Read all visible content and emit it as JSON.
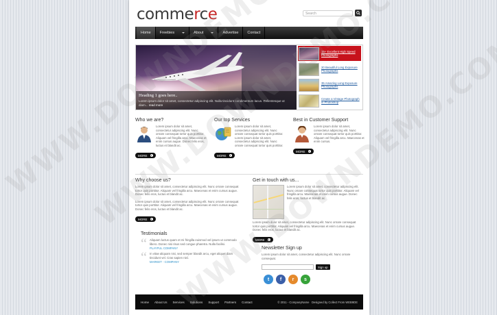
{
  "site": {
    "logo_prefix": "comme",
    "logo_accent": "r",
    "logo_mid": "c",
    "logo_suffix": "e"
  },
  "search": {
    "placeholder": "Search",
    "icon": "search-icon"
  },
  "nav": {
    "items": [
      {
        "label": "Home",
        "active": true
      },
      {
        "label": "Freebies",
        "dropdown": true
      },
      {
        "label": "About",
        "dropdown": true
      },
      {
        "label": "Advertise"
      },
      {
        "label": "Contact"
      }
    ]
  },
  "slider": {
    "hero_title": "Heading 1 goes here..",
    "hero_text": "Lorem ipsum dolor sit amet, consectetur adipiscing elit. Nulla tincidunt condimentum lacus. Pellentesque ut diam...",
    "hero_more": "read more",
    "thumbs": [
      {
        "caption": "15+ Excellent High Speed Photographs",
        "active": true
      },
      {
        "caption": "20 Beautiful Long Exposure Photographs"
      },
      {
        "caption": "35 Amazing Long Exposure Photographs"
      },
      {
        "caption": "Create a Vintage Photograph in Photoshop"
      }
    ]
  },
  "features": [
    {
      "title": "Who we are?",
      "icon": "person-icon",
      "text": "Lorem ipsum dolor sit amet, consectetur adipiscing elit. Nunc ornare consequat tortor quis porttitor. Aliquam vel fringilla arcu. Maecenas et enim cursus augue. Donec felis eros, luctus et blandit ac.",
      "more": "MORE"
    },
    {
      "title": "Our top Services",
      "icon": "globe-icon",
      "text": "Lorem ipsum dolor sit amet, consectetur adipiscing elit. Nunc ornare consequat tortor quis porttitor. Lorem ipsum dolor sit amet, consectetur adipiscing elit. Nunc ornare consequat tortor quis porttitor.",
      "more": "MORE"
    },
    {
      "title": "Best in Customer Support",
      "icon": "support-person-icon",
      "text": "Lorem ipsum dolor sit amet, consectetur adipiscing elit. Nunc ornare consequat tortor quis porttitor. Aliquam vel fringilla arcu. Maecenas et enim cursus.",
      "more": "MORE"
    }
  ],
  "why": {
    "title": "Why choose us?",
    "p1": "Lorem ipsum dolor sit amet, consectetur adipiscing elit. Nunc ornare consequat tortor quis porttitor. Aliquam vel fringilla arcu. Maecenas et enim cursus augue. Donec felis eros, luctus et blandit ac.",
    "p2": "Lorem ipsum dolor sit amet, consectetur adipiscing elit. Nunc ornare consequat tortor quis porttitor. Aliquam vel fringilla arcu. Maecenas et enim cursus augue. Donec felis eros, luctus et blandit ac.",
    "more": "MORE"
  },
  "contact": {
    "title": "Get in touch with us...",
    "text1": "Lorem ipsum dolor sit amet, consectetur adipiscing elit. Nunc ornare consequat tortor quis porttitor. Aliquam vel fringilla arcu. Maecenas et enim cursus augue. Donec felis eros, luctus et blandit ac.",
    "text2": "Lorem ipsum dolor sit amet, consectetur adipiscing elit. Nunc ornare consequat tortor quis porttitor. Aliquam vel fringilla arcu. Maecenas et enim cursus augue. Donec felis eros, luctus et blandit ac.",
    "more": "MORE"
  },
  "testimonials": {
    "title": "Testimonials",
    "items": [
      {
        "text": "Aliquam luctus quam et mi fringilla euismod vel ipsum ut commodo libero. Donec nisi risus sed congue pharetra. Nulla facilisi.",
        "author": "PLAYFUL COMPANY"
      },
      {
        "text": "In vitae aliquam nisi, sed semper blandit arcu, eget aliquet diam tincidunt vel. Cras sapien nisl.",
        "author": "MARKET - COMPANY"
      }
    ]
  },
  "newsletter": {
    "title": "Newsletter Sign up",
    "text": "Lorem ipsum dolor sit amet, consectetur adipiscing elit. Nunc ornare consequat.",
    "button": "Sign up",
    "social": [
      {
        "icon": "twitter-icon",
        "color": "#3a8fd6",
        "glyph": "t"
      },
      {
        "icon": "facebook-icon",
        "color": "#3b5fa8",
        "glyph": "f"
      },
      {
        "icon": "rss-icon",
        "color": "#e58a2c",
        "glyph": "r"
      },
      {
        "icon": "skype-icon",
        "color": "#37a33a",
        "glyph": "s"
      }
    ]
  },
  "footer": {
    "links": [
      "Home",
      "About Us",
      "Services",
      "Solutions",
      "Support",
      "Partners",
      "Contact"
    ],
    "copyright": "© 2011 - CompanyName",
    "credit": "Designed by Collect From WEB9DE"
  },
  "watermark": {
    "text": "WWW.DOWNDEMO.COM"
  },
  "colors": {
    "accent": "#c62828",
    "nav": "#1a1a1a",
    "link": "#1f5a9e"
  }
}
